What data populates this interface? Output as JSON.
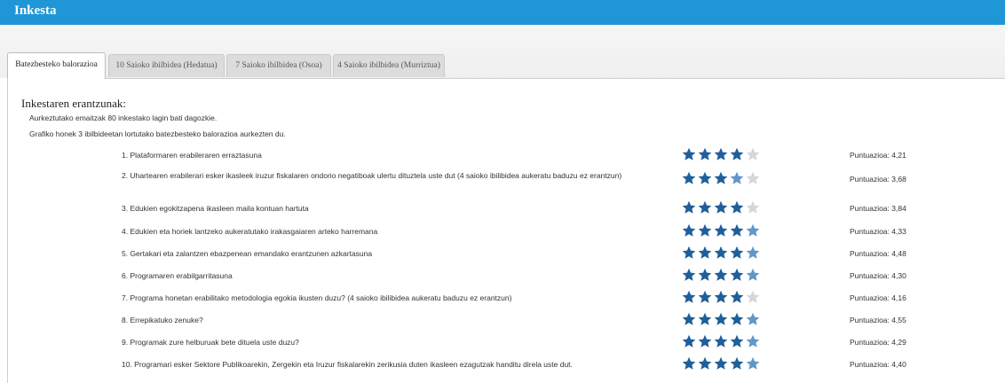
{
  "header": {
    "title": "Inkesta"
  },
  "tabs": [
    {
      "label": "Batezbesteko balorazioa",
      "active": true
    },
    {
      "label": "10 Saioko ibilbidea (Hedatua)",
      "active": false
    },
    {
      "label": "7 Saioko ibilbidea (Osoa)",
      "active": false
    },
    {
      "label": "4 Saioko ibilbidea (Murriztua)",
      "active": false
    }
  ],
  "survey": {
    "heading": "Inkestaren erantzunak:",
    "intro1": "Aurkeztutako emaitzak 80 inkestako lagin bati dagozkie.",
    "intro2": "Grafiko honek 3 ibilbideetan lortutako batezbesteko balorazioa aurkezten du.",
    "score_prefix": "Puntuazioa: ",
    "colors": {
      "star_full": "#1f5f9a",
      "star_partial": "#5f97c8",
      "star_empty": "#d3d7db"
    },
    "questions": [
      {
        "text": "1. Plataformaren erabileraren erraztasuna",
        "score": "4,21",
        "value": 4.21
      },
      {
        "text": "2. Uhartearen erabilerari esker ikasleek iruzur fiskalaren ondorio negatiboak ulertu dituztela uste dut (4 saioko ibilibidea aukeratu baduzu ez erantzun)",
        "score": "3,68",
        "value": 3.68
      },
      {
        "text": "3. Edukien egokitzapena ikasleen maila kontuan hartuta",
        "score": "3,84",
        "value": 3.84
      },
      {
        "text": "4. Edukien eta horiek lantzeko aukeratutako irakasgaiaren arteko harremana",
        "score": "4,33",
        "value": 4.33
      },
      {
        "text": "5. Gertakari eta zalantzen ebazpenean emandako erantzunen azkartasuna",
        "score": "4,48",
        "value": 4.48
      },
      {
        "text": "6. Programaren erabilgarritasuna",
        "score": "4,30",
        "value": 4.3
      },
      {
        "text": "7. Programa honetan erabilitako metodologia egokia ikusten duzu? (4 saioko ibilibidea aukeratu baduzu ez erantzun)",
        "score": "4,16",
        "value": 4.16
      },
      {
        "text": "8. Errepikatuko zenuke?",
        "score": "4,55",
        "value": 4.55
      },
      {
        "text": "9. Programak zure helburuak bete dituela uste duzu?",
        "score": "4,29",
        "value": 4.29
      },
      {
        "text": "10. Programari esker Sektore Publikoarekin, Zergekin eta Iruzur fiskalarekin zerikusia duten ikasleen ezagutzak handitu direla uste dut.",
        "score": "4,40",
        "value": 4.4
      }
    ]
  }
}
